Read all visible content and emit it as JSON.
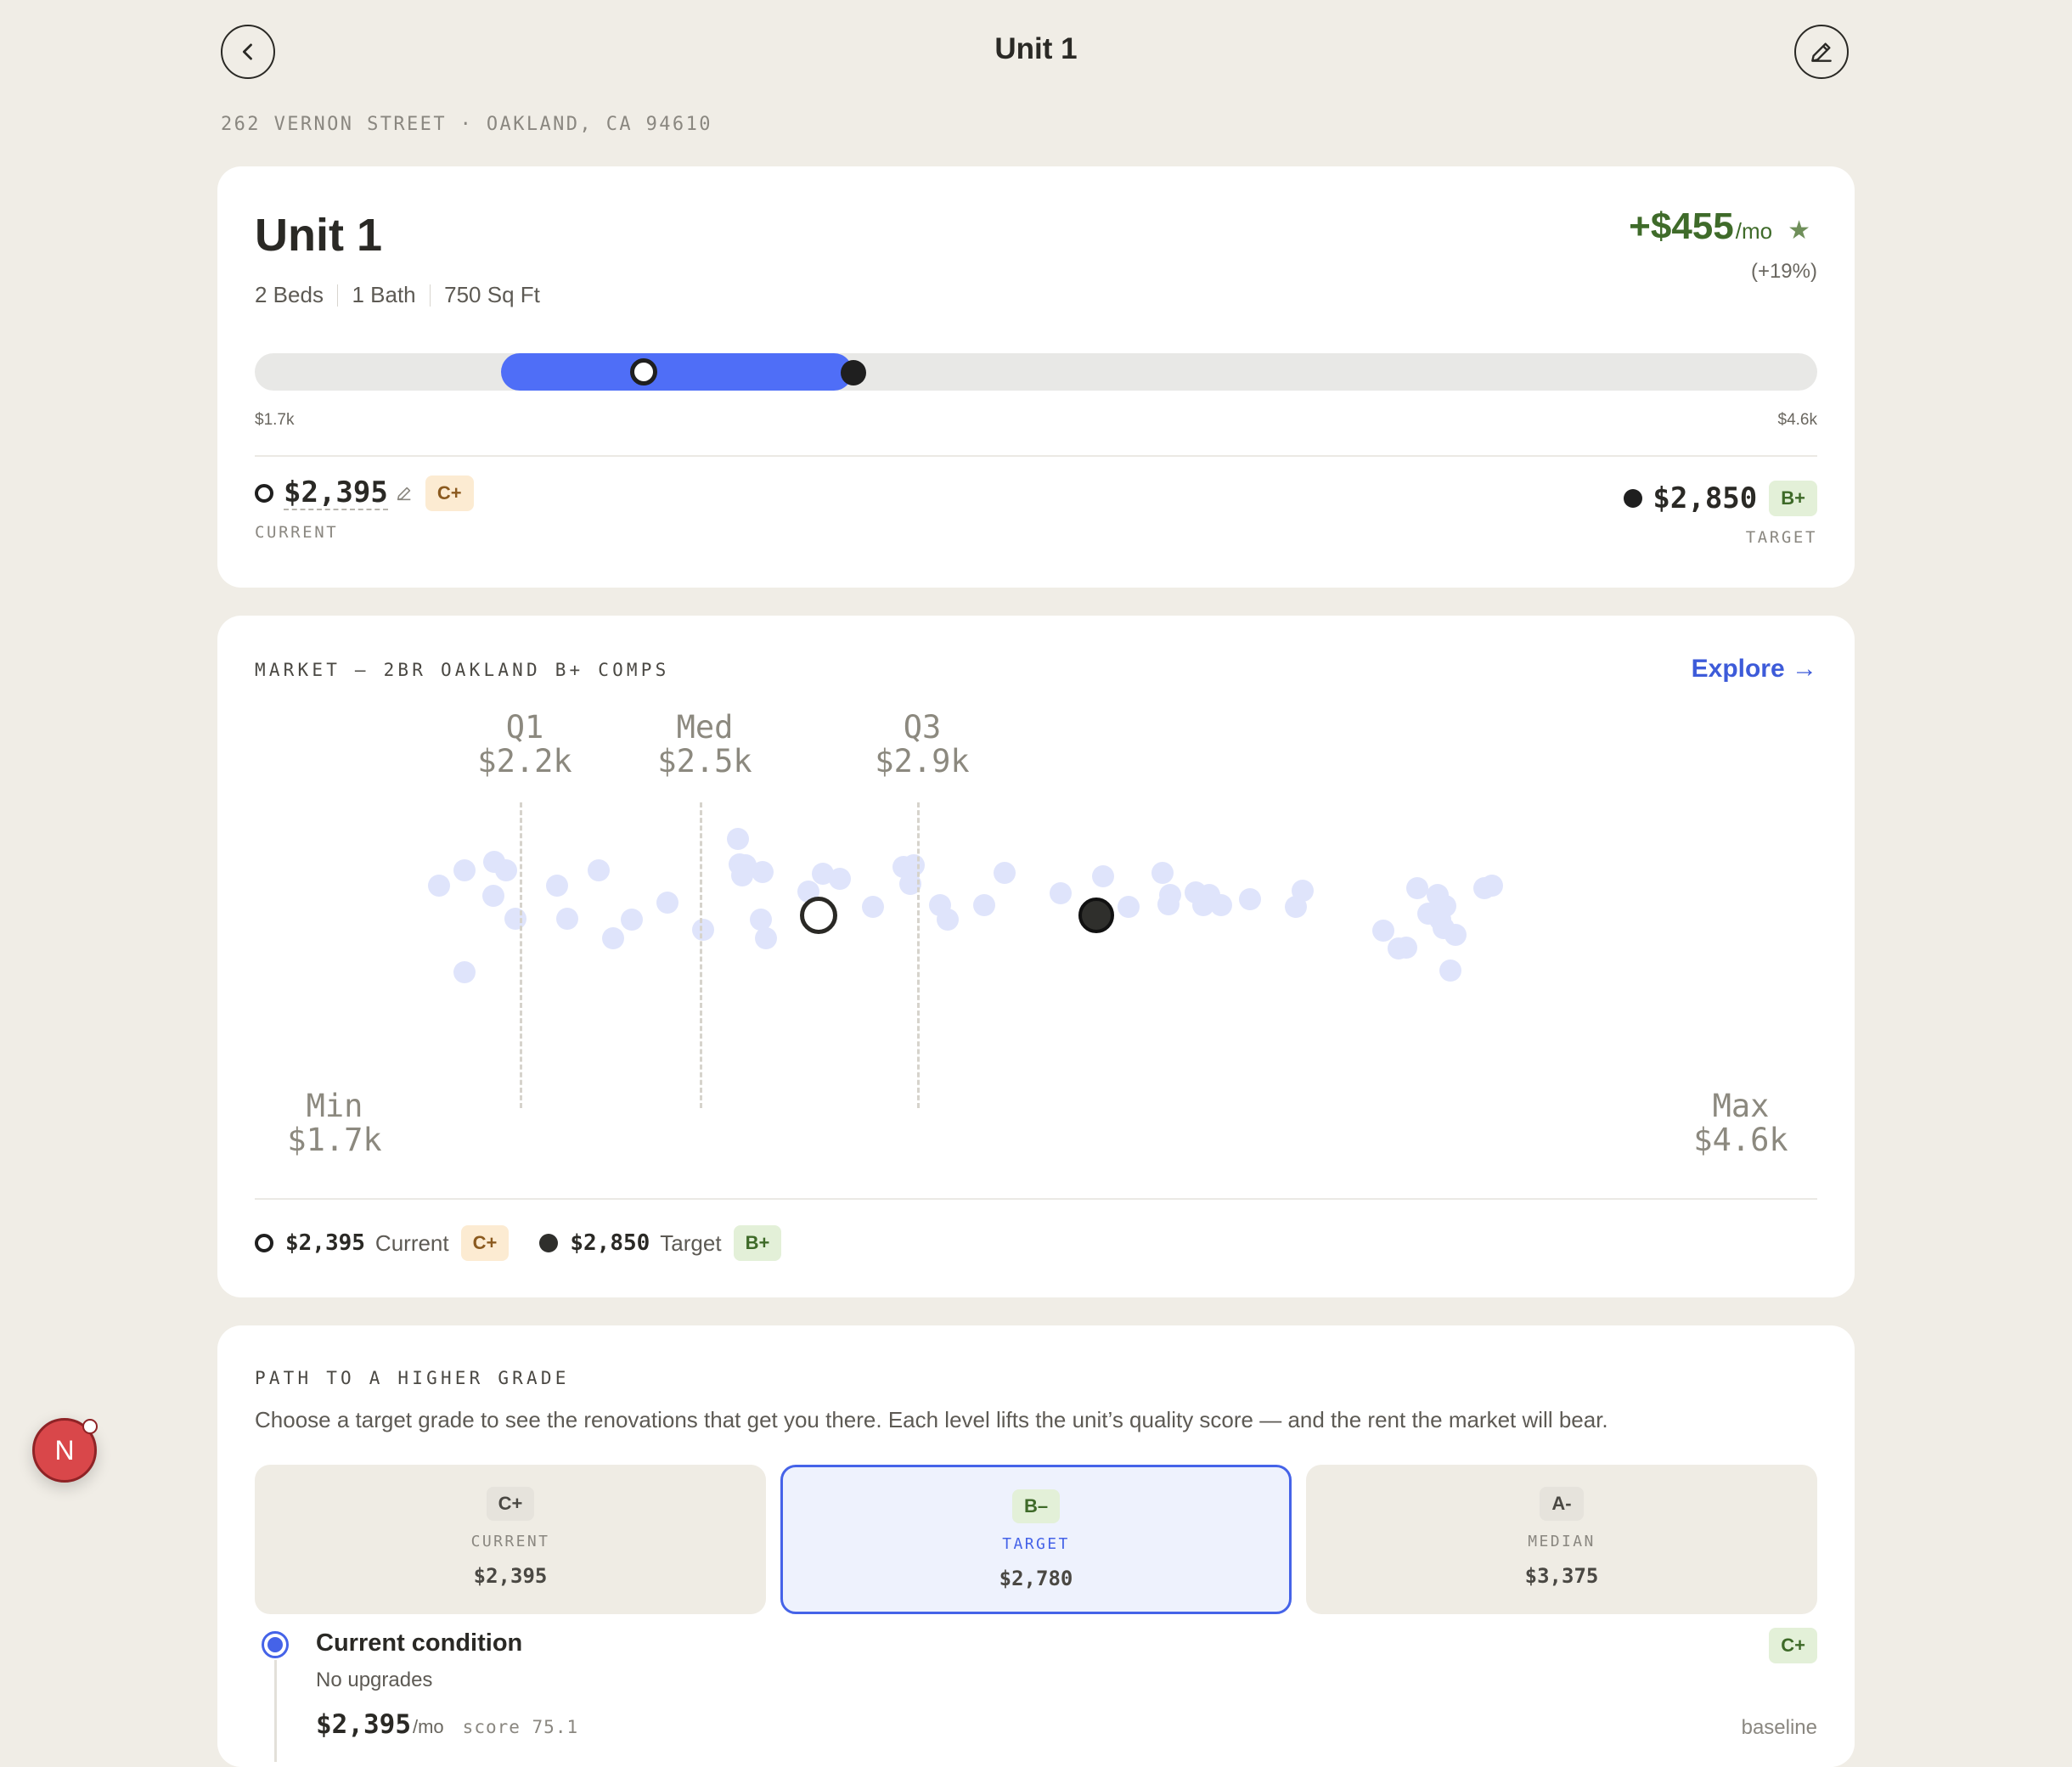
{
  "header": {
    "title": "Unit 1",
    "back_icon": "chevron-left-icon",
    "edit_icon": "pencil-icon",
    "address": "262 VERNON STREET · OAKLAND, CA 94610"
  },
  "summary": {
    "unit_name": "Unit 1",
    "specs": [
      "2 Beds",
      "1 Bath",
      "750 Sq Ft"
    ],
    "delta_amount": "+$455",
    "delta_unit": "/mo",
    "delta_pct": "(+19%)",
    "range": {
      "min_label": "$1.7k",
      "max_label": "$4.6k",
      "min": 1700,
      "max": 4600,
      "current": 2395,
      "target": 2850
    },
    "current": {
      "amount": "$2,395",
      "grade": "C+",
      "label": "CURRENT"
    },
    "target": {
      "amount": "$2,850",
      "grade": "B+",
      "label": "TARGET"
    }
  },
  "market": {
    "label": "MARKET — 2BR OAKLAND B+ COMPS",
    "explore": "Explore →",
    "q1": {
      "name": "Q1",
      "value": "$2.2k"
    },
    "median": {
      "name": "Med",
      "value": "$2.5k"
    },
    "q3": {
      "name": "Q3",
      "value": "$2.9k"
    },
    "min": {
      "name": "Min",
      "value": "$1.7k"
    },
    "max": {
      "name": "Max",
      "value": "$4.6k"
    },
    "legend": {
      "current_amount": "$2,395",
      "current_label": "Current",
      "current_grade": "C+",
      "target_amount": "$2,850",
      "target_label": "Target",
      "target_grade": "B+"
    }
  },
  "path": {
    "label": "PATH TO A HIGHER GRADE",
    "description": "Choose a target grade to see the renovations that get you there. Each level lifts the unit’s quality score — and the rent the market will bear.",
    "tiers": [
      {
        "grade": "C+",
        "label": "CURRENT",
        "price": "$2,395"
      },
      {
        "grade": "B–",
        "label": "TARGET",
        "price": "$2,780"
      },
      {
        "grade": "A-",
        "label": "MEDIAN",
        "price": "$3,375"
      }
    ],
    "step": {
      "title": "Current condition",
      "subtitle": "No upgrades",
      "grade": "C+",
      "price": "$2,395",
      "price_unit": "/mo",
      "score": "score 75.1",
      "note": "baseline"
    }
  },
  "fab": {
    "letter": "N"
  },
  "colors": {
    "accent": "#4f6ef7",
    "positive": "#3f6b2a",
    "background": "#f0ede6"
  }
}
